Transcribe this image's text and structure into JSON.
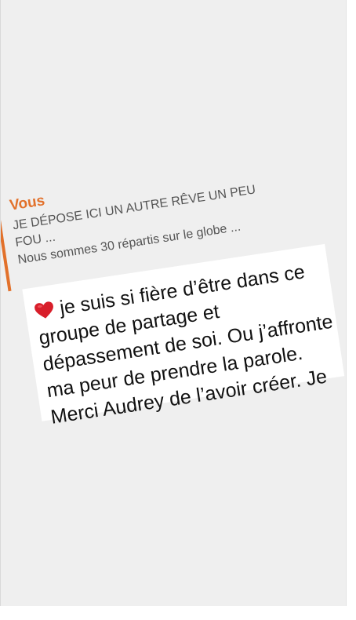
{
  "reply_quote": {
    "sender": "Vous",
    "lines": [
      "JE DÉPOSE ICI UN AUTRE RÊVE UN PEU",
      "FOU ...",
      "Nous sommes 30 répartis sur le globe ..."
    ]
  },
  "message": {
    "emoji_icon": "red-heart-icon",
    "lines": [
      "je suis si fière d’être dans ce",
      "groupe de partage et",
      "dépassement de soi. Ou j’affronte",
      "ma peur de prendre la parole.",
      "Merci Audrey de l’avoir créer. Je"
    ]
  },
  "colors": {
    "accent": "#e2712b",
    "heart": "#d81e2a",
    "background": "#efefef"
  }
}
